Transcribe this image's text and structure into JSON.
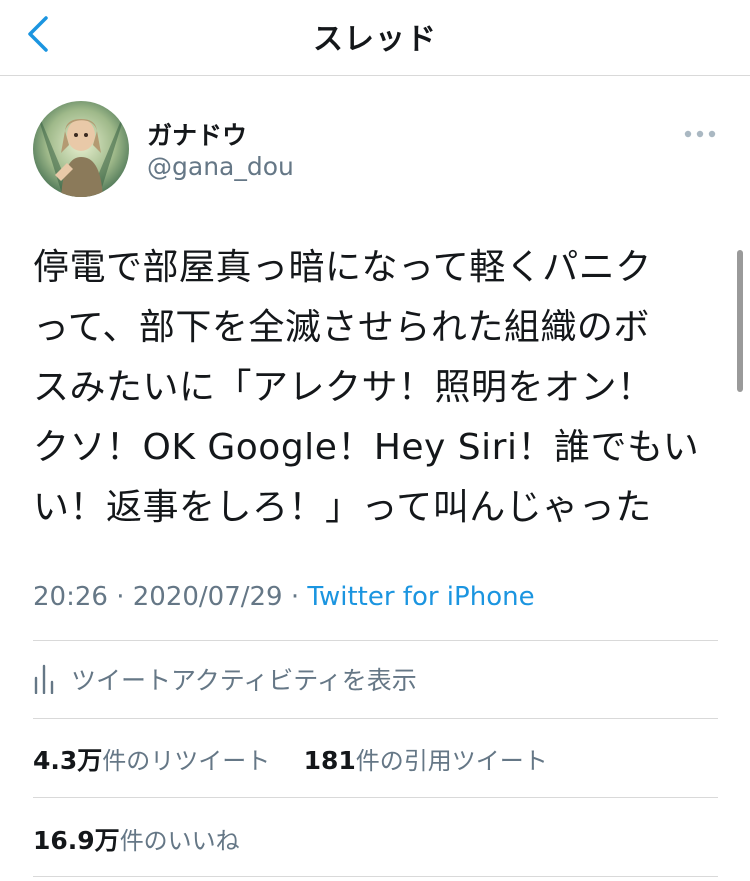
{
  "header": {
    "title": "スレッド",
    "back_icon": "chevron-left-icon"
  },
  "tweet": {
    "author": {
      "display_name": "ガナドウ",
      "handle": "@gana_dou"
    },
    "text_lines": [
      "停電で部屋真っ暗になって軽くパニク",
      "って、部下を全滅させられた組織のボ",
      "スみたいに「アレクサ！照明をオン！",
      "クソ！OK Google！Hey Siri！誰でもい",
      "い！返事をしろ！」って叫んじゃった"
    ],
    "time": "20:26",
    "separator": "·",
    "date": "2020/07/29",
    "source": "Twitter for iPhone"
  },
  "activity": {
    "label": "ツイートアクティビティを表示",
    "icon": "bar-chart-icon"
  },
  "stats": {
    "retweets_count": "4.3万",
    "retweets_label": "件のリツイート",
    "quotes_count": "181",
    "quotes_label": "件の引用ツイート",
    "likes_count": "16.9万",
    "likes_label": "件のいいね"
  },
  "colors": {
    "accent": "#1b95e0",
    "secondary_text": "#657786",
    "divider": "#d9d9d9"
  }
}
